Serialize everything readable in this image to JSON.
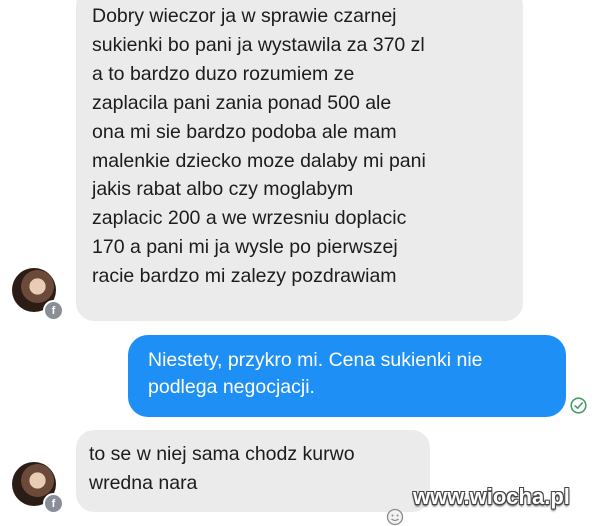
{
  "conversation": {
    "messages": [
      {
        "sender": "other",
        "lines": [
          "Dobry wieczor ja w sprawie czarnej",
          "sukienki bo pani ja wystawila za 370 zl",
          "a to bardzo duzo rozumiem ze",
          "zaplacila pani zania ponad 500 ale",
          "ona mi sie bardzo podoba ale mam",
          "malenkie dziecko moze dalaby mi pani",
          "jakis rabat albo czy moglabym",
          "zaplacic 200 a we wrzesniu doplacic",
          "170 a pani mi ja wysle po pierwszej",
          "racie bardzo mi zalezy pozdrawiam"
        ]
      },
      {
        "sender": "me",
        "lines": [
          "Niestety, przykro mi. Cena sukienki nie",
          "podlega negocjacji."
        ]
      },
      {
        "sender": "other",
        "lines": [
          "to se w niej sama chodz kurwo",
          "wredna nara"
        ]
      }
    ]
  },
  "badge": {
    "letter": "f"
  },
  "watermark": {
    "text": "www.wiocha.pl"
  },
  "colors": {
    "incoming_bubble": "#ebebeb",
    "outgoing_bubble": "#1e8ff5",
    "seen_indicator": "#4a9a6a"
  },
  "icons": {
    "avatar": "profile-photo",
    "badge": "facebook-badge-icon",
    "seen": "check-circle-icon",
    "reaction": "smiley-icon"
  }
}
